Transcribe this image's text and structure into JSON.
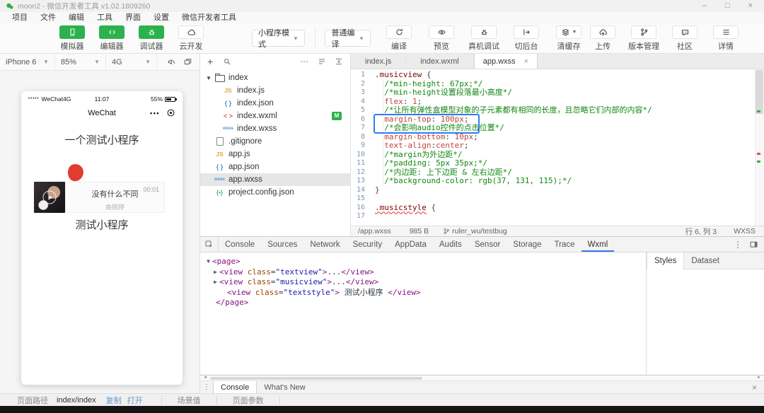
{
  "window": {
    "title": "moon2 - 微信开发者工具 v1.02.1809260",
    "controls": {
      "minimize": "–",
      "maximize": "□",
      "close": "×"
    }
  },
  "menu": {
    "items": [
      "项目",
      "文件",
      "编辑",
      "工具",
      "界面",
      "设置",
      "微信开发者工具"
    ]
  },
  "toolbar": {
    "left_buttons": [
      {
        "label": "模拟器",
        "icon": "simulator-phone-icon",
        "style": "green"
      },
      {
        "label": "编辑器",
        "icon": "editor-code-icon",
        "style": "green"
      },
      {
        "label": "调试器",
        "icon": "debugger-bug-icon",
        "style": "green"
      },
      {
        "label": "云开发",
        "icon": "cloud-dev-icon",
        "style": "white"
      }
    ],
    "mode_select": {
      "value": "小程序模式"
    },
    "compile_select": {
      "value": "普通编译"
    },
    "actions": [
      {
        "label": "编译",
        "icon": "compile-refresh-icon"
      },
      {
        "label": "预览",
        "icon": "preview-eye-icon"
      },
      {
        "label": "真机调试",
        "icon": "remote-debug-icon"
      },
      {
        "label": "切后台",
        "icon": "background-switch-icon"
      },
      {
        "label": "清缓存",
        "icon": "clear-cache-icon",
        "has_caret": true
      }
    ],
    "right_actions": [
      {
        "label": "上传",
        "icon": "upload-cloud-icon"
      },
      {
        "label": "版本管理",
        "icon": "version-branch-icon"
      },
      {
        "label": "社区",
        "icon": "community-chat-icon"
      },
      {
        "label": "详情",
        "icon": "details-menu-icon"
      }
    ]
  },
  "simulator": {
    "device": "iPhone 6",
    "scale": "85%",
    "network": "4G",
    "phone": {
      "signal_dots": "•••••",
      "carrier": "WeChat4G",
      "time": "11:07",
      "battery": "55%",
      "nav_title": "WeChat",
      "menu_dots": "•••",
      "page_title": "一个测试小程序",
      "song_title": "没有什么不同",
      "song_artist": "曲婉婷",
      "song_time": "00:01",
      "footer_text": "测试小程序"
    }
  },
  "explorer": {
    "files": [
      {
        "name": "index",
        "icon": "folder-open-icon",
        "depth": 0,
        "arrow": "down"
      },
      {
        "name": "index.js",
        "icon": "js-icon",
        "depth": 1
      },
      {
        "name": "index.json",
        "icon": "json-icon",
        "depth": 1
      },
      {
        "name": "index.wxml",
        "icon": "wxml-icon",
        "depth": 1,
        "badge": "M"
      },
      {
        "name": "index.wxss",
        "icon": "wxss-icon",
        "depth": 1
      },
      {
        "name": ".gitignore",
        "icon": "file-icon",
        "depth": 0
      },
      {
        "name": "app.js",
        "icon": "js-icon",
        "depth": 0
      },
      {
        "name": "app.json",
        "icon": "json-icon",
        "depth": 0
      },
      {
        "name": "app.wxss",
        "icon": "wxss-icon",
        "depth": 0,
        "selected": true
      },
      {
        "name": "project.config.json",
        "icon": "config-icon",
        "depth": 0
      }
    ]
  },
  "editor": {
    "tabs": [
      {
        "label": "index.js"
      },
      {
        "label": "index.wxml"
      },
      {
        "label": "app.wxss",
        "active": true,
        "close": "×"
      }
    ],
    "lines": [
      [
        [
          "sel",
          ".musicview"
        ],
        [
          "pln",
          " {"
        ]
      ],
      [
        [
          "com",
          "  /*min-height: 67px;*/"
        ]
      ],
      [
        [
          "com",
          "  /*min-height设置段落最小高度*/"
        ]
      ],
      [
        [
          "pln",
          "  "
        ],
        [
          "prop",
          "flex"
        ],
        [
          "pln",
          ": "
        ],
        [
          "val",
          "1"
        ],
        [
          "pln",
          ";"
        ]
      ],
      [
        [
          "com",
          "  /*让所有弹性盒模型对象的子元素都有相同的长度，且忽略它们内部的内容*/"
        ]
      ],
      [
        [
          "pln",
          "  "
        ],
        [
          "prop",
          "margin-top"
        ],
        [
          "pln",
          ": "
        ],
        [
          "val",
          "100px"
        ],
        [
          "pln",
          ";"
        ]
      ],
      [
        [
          "com",
          "  /*会影响audio控件的点击位置*/"
        ]
      ],
      [
        [
          "pln",
          "  "
        ],
        [
          "prop",
          "margin-bottom"
        ],
        [
          "pln",
          ": "
        ],
        [
          "val",
          "10px"
        ],
        [
          "pln",
          ";"
        ]
      ],
      [
        [
          "pln",
          "  "
        ],
        [
          "prop",
          "text-align"
        ],
        [
          "pln",
          ":"
        ],
        [
          "val",
          "center"
        ],
        [
          "pln",
          ";"
        ]
      ],
      [
        [
          "com",
          "  /*margin为外边距*/"
        ]
      ],
      [
        [
          "com",
          "  /*padding: 5px 35px;*/"
        ]
      ],
      [
        [
          "com",
          "  /*内边距: 上下边距 & 左右边距*/"
        ]
      ],
      [
        [
          "com",
          "  /*background-color: rgb(37, 131, 115);*/"
        ]
      ],
      [
        [
          "pln",
          "}"
        ]
      ],
      [],
      [
        [
          "selw",
          ".musicstyle"
        ],
        [
          "pln",
          " {"
        ]
      ],
      []
    ],
    "status": {
      "path": "/app.wxss",
      "size": "985 B",
      "branch": "ruler_wu/testbug",
      "cursor": "行 6, 列 3",
      "language": "WXSS"
    }
  },
  "devtools": {
    "tabs": [
      "Console",
      "Sources",
      "Network",
      "Security",
      "AppData",
      "Audits",
      "Sensor",
      "Storage",
      "Trace",
      "Wxml"
    ],
    "active_tab": "Wxml",
    "wxml_lines": [
      {
        "arrow": "down",
        "pad": 0,
        "tokens": [
          [
            "tag",
            "<page>"
          ]
        ]
      },
      {
        "arrow": "right",
        "pad": 10,
        "tokens": [
          [
            "tag",
            "<view"
          ],
          [
            "pln",
            " "
          ],
          [
            "attr",
            "class"
          ],
          [
            "pln",
            "="
          ],
          [
            "str",
            "\"textview\""
          ],
          [
            "tag",
            ">"
          ],
          [
            "pln",
            "..."
          ],
          [
            "tag",
            "</view>"
          ]
        ]
      },
      {
        "arrow": "right",
        "pad": 10,
        "tokens": [
          [
            "tag",
            "<view"
          ],
          [
            "pln",
            " "
          ],
          [
            "attr",
            "class"
          ],
          [
            "pln",
            "="
          ],
          [
            "str",
            "\"musicview\""
          ],
          [
            "tag",
            ">"
          ],
          [
            "pln",
            "..."
          ],
          [
            "tag",
            "</view>"
          ]
        ]
      },
      {
        "arrow": "none",
        "pad": 21,
        "tokens": [
          [
            "tag",
            "<view"
          ],
          [
            "pln",
            " "
          ],
          [
            "attr",
            "class"
          ],
          [
            "pln",
            "="
          ],
          [
            "str",
            "\"textstyle\""
          ],
          [
            "tag",
            ">"
          ],
          [
            "pln",
            " 测试小程序 "
          ],
          [
            "tag",
            "</view>"
          ]
        ]
      },
      {
        "arrow": "none",
        "pad": 5,
        "tokens": [
          [
            "tag",
            "</page>"
          ]
        ]
      }
    ],
    "side_tabs": [
      {
        "label": "Styles",
        "active": true
      },
      {
        "label": "Dataset"
      }
    ]
  },
  "drawer": {
    "tabs": [
      {
        "label": "Console",
        "active": true
      },
      {
        "label": "What's New"
      }
    ],
    "close": "×"
  },
  "statusbar": {
    "path_label": "页面路径",
    "path_value": "index/index",
    "copy_link": "复制",
    "open_link": "打开",
    "scene_label": "场景值",
    "params_label": "页面参数"
  },
  "colors": {
    "wechat_green": "#2bb24c",
    "highlight_blue": "#2f7bf5",
    "link_blue": "#6a98c8",
    "selector_maroon": "#800000",
    "property_red": "#c0443c",
    "comment_green": "#128712"
  }
}
